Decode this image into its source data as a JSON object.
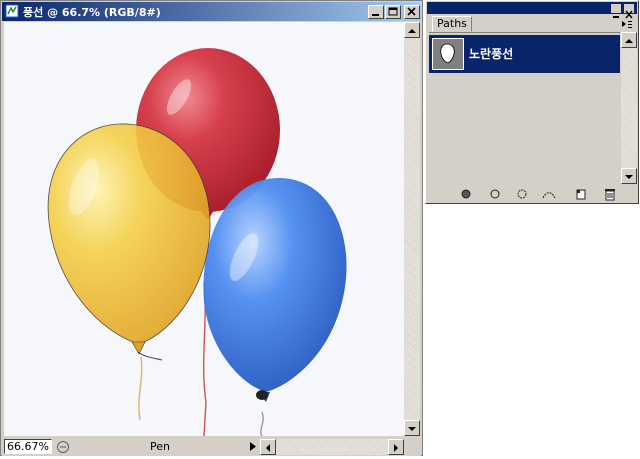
{
  "document": {
    "title": "풍선 @ 66.7% (RGB/8#)",
    "zoom_value": "66.67%",
    "tool_label": "Pen",
    "icons": [
      "document-icon",
      "minimize-icon",
      "maximize-icon",
      "close-icon",
      "scroll-up-icon",
      "scroll-down-icon",
      "scroll-left-icon",
      "scroll-right-icon",
      "status-info-icon",
      "status-menu-arrow-icon"
    ]
  },
  "paths_panel": {
    "tab_label": "Paths",
    "paths": [
      {
        "name": "노란풍선",
        "selected": true
      }
    ],
    "footer_icons": [
      "fill-path-icon",
      "stroke-path-icon",
      "load-selection-icon",
      "make-work-path-icon",
      "new-path-icon",
      "delete-path-icon"
    ]
  },
  "colors": {
    "title_active": "#0a246a",
    "title_gradient_end": "#a6caf0",
    "chrome": "#d4d0c8",
    "selection": "#0a246a",
    "balloon_yellow": "#f1c43a",
    "balloon_red": "#c8333f",
    "balloon_blue": "#3c7ae0"
  }
}
